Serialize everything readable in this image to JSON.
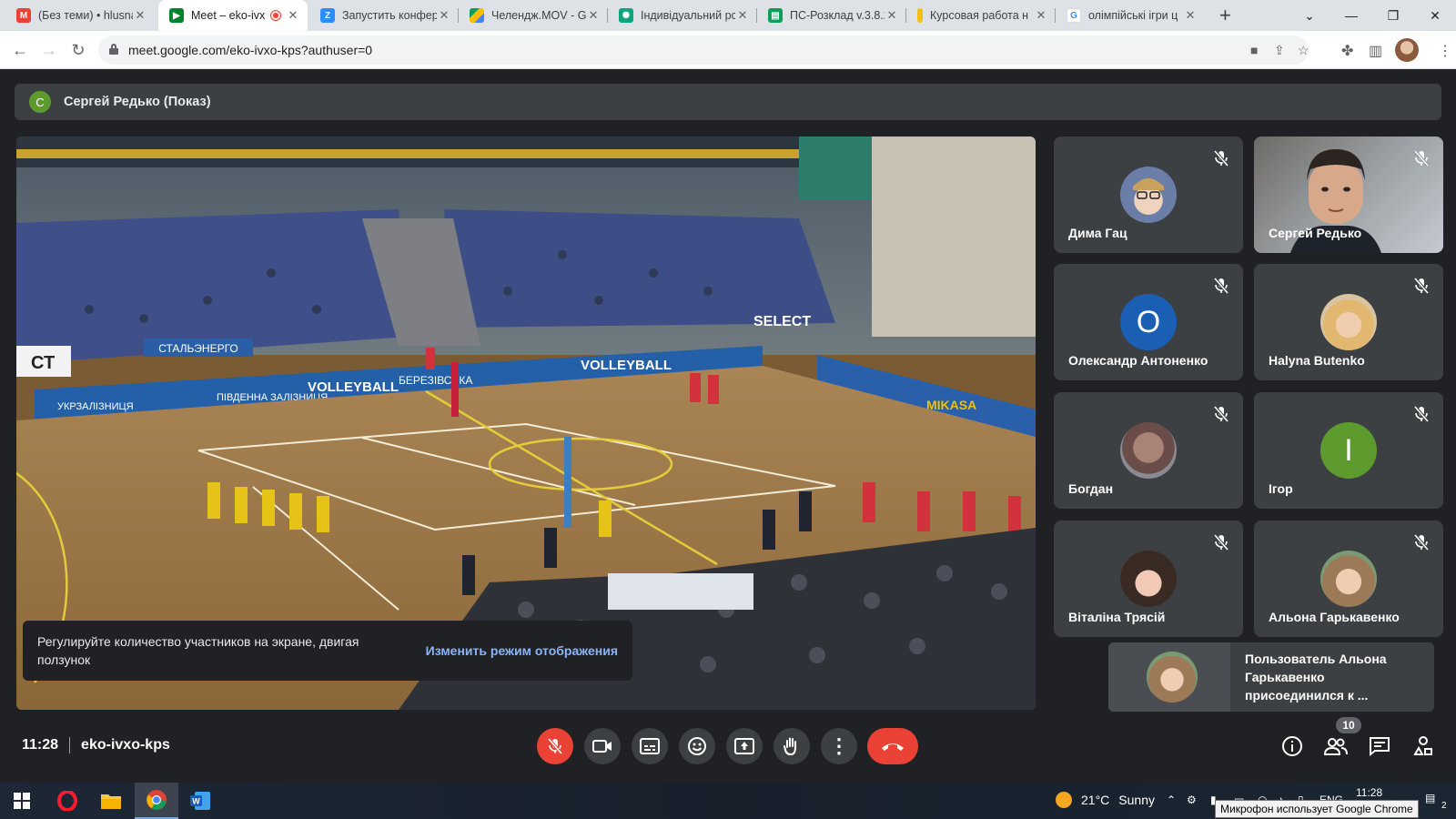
{
  "browser": {
    "tabs": [
      {
        "title": "(Без теми) • hlusna",
        "favicon": "gmail-icon",
        "color": "#ea4335"
      },
      {
        "title": "Meet – eko-ivx",
        "favicon": "meet-icon",
        "color": "#00832d",
        "recording": true
      },
      {
        "title": "Запустить конфер",
        "favicon": "zoom-icon",
        "color": "#2d8cff"
      },
      {
        "title": "Челендж.MOV - G",
        "favicon": "drive-icon",
        "color": "#fbbc04"
      },
      {
        "title": "Індивідуальний рс",
        "favicon": "chatgpt-icon",
        "color": "#10a37f"
      },
      {
        "title": "ПС-Розклад v.3.8.2",
        "favicon": "sheet-icon",
        "color": "#0f9d58"
      },
      {
        "title": "Курсовая работа н",
        "favicon": "yellow-icon",
        "color": "#f4c20d"
      },
      {
        "title": "олімпійські ігри ц",
        "favicon": "google-icon",
        "color": "#4285f4"
      }
    ],
    "url": "meet.google.com/eko-ivxo-kps?authuser=0"
  },
  "meet": {
    "presenter_label": "Сергей Редько (Показ)",
    "presenter_initial": "С",
    "participants": [
      {
        "name": "Дима Гац",
        "type": "photo"
      },
      {
        "name": "Сергей Редько",
        "type": "video"
      },
      {
        "name": "Олександр Антоненко",
        "type": "initial",
        "initial": "О",
        "color": "#1a5fb4"
      },
      {
        "name": "Halyna Butenko",
        "type": "photo"
      },
      {
        "name": "Богдан",
        "type": "photo"
      },
      {
        "name": "Ігор",
        "type": "initial",
        "initial": "I",
        "color": "#5e9b2e"
      },
      {
        "name": "Віталіна Трясій",
        "type": "photo"
      },
      {
        "name": "Альона Гарькавенко",
        "type": "photo"
      }
    ],
    "toast": {
      "text": "Регулируйте количество участников на экране, двигая ползунок",
      "action": "Изменить режим отображения"
    },
    "notification": "Пользователь Альона Гарькавенко присоединился к ...",
    "meeting_time": "11:28",
    "meeting_code": "eko-ivxo-kps",
    "participant_count": "10",
    "shared_screen_banners": [
      "СТАЛЬЭНЕРГО",
      "ПІВДЕННА ЗАЛІЗНИЦЯ",
      "VOLLEYBALL",
      "БЕРЕЗІВСЬКА",
      "SELECT",
      "MIKASA",
      "УКРЗАЛІЗНИЦЯ",
      "СТ"
    ]
  },
  "taskbar": {
    "temperature": "21°C",
    "weather": "Sunny",
    "language": "ENG",
    "clock": "11:28",
    "notification_count": "2",
    "tooltip": "Микрофон использует Google Chrome"
  },
  "colors": {
    "meet_bg": "#202124",
    "tile_bg": "#3c4043",
    "danger": "#ea4335",
    "link": "#8ab4f8"
  }
}
